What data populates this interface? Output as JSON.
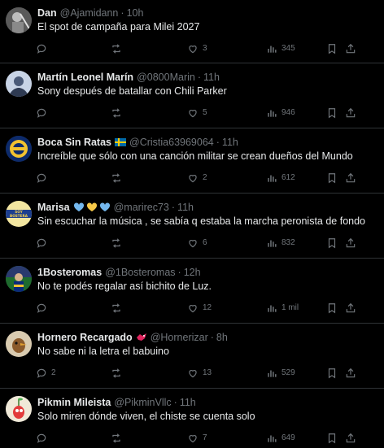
{
  "tweets": [
    {
      "name": "Dan",
      "handle": "@Ajamidann",
      "time": "10h",
      "text": "El spot de campaña para Milei 2027",
      "replies": "",
      "retweets": "",
      "likes": "3",
      "views": "345"
    },
    {
      "name": "Martín Leonel Marín",
      "handle": "@0800Marin",
      "time": "11h",
      "text": "Sony después de batallar con Chili Parker",
      "replies": "",
      "retweets": "",
      "likes": "5",
      "views": "946"
    },
    {
      "name": "Boca Sin Ratas",
      "badge_icon": "sweden-flag-icon",
      "handle": "@Cristia63969064",
      "time": "11h",
      "text": "Increíble que sólo con una canción militar se crean dueños del Mundo",
      "replies": "",
      "retweets": "",
      "likes": "2",
      "views": "612"
    },
    {
      "name": "Marisa",
      "badge_icon": "hearts-icon",
      "handle": "@marirec73",
      "time": "11h",
      "text": "Sin escuchar la música , se sabía q estaba la marcha peronista de fondo",
      "replies": "",
      "retweets": "",
      "likes": "6",
      "views": "832",
      "avatar_text": "SOY BOSTERA"
    },
    {
      "name": "1Bosteromas",
      "handle": "@1Bosteromas",
      "time": "12h",
      "text": "No te podés regalar así bichito de Luz.",
      "replies": "",
      "retweets": "",
      "likes": "12",
      "views": "1 mil"
    },
    {
      "name": "Hornero Recargado",
      "badge_icon": "bird-icon",
      "handle": "@Hornerizar",
      "time": "8h",
      "text": "No sabe ni la letra el babuino",
      "replies": "2",
      "retweets": "",
      "likes": "13",
      "views": "529"
    },
    {
      "name": "Pikmin Mileista",
      "handle": "@PikminVllc",
      "time": "11h",
      "text": "Solo miren dónde viven, el chiste se cuenta solo",
      "replies": "",
      "retweets": "",
      "likes": "7",
      "views": "649"
    }
  ],
  "colors": {
    "background": "#000000",
    "text": "#e7e9ea",
    "muted": "#71767b",
    "divider": "#2f3336"
  }
}
